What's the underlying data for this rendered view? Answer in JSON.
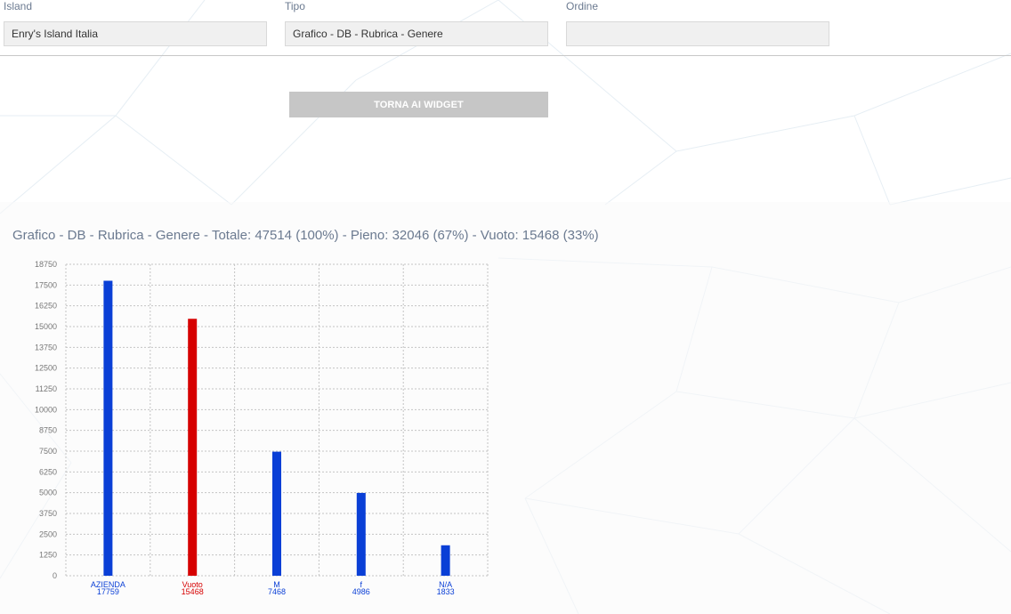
{
  "form": {
    "island": {
      "label": "Island",
      "value": "Enry's Island Italia"
    },
    "tipo": {
      "label": "Tipo",
      "value": "Grafico - DB - Rubrica - Genere"
    },
    "ordine": {
      "label": "Ordine",
      "value": ""
    }
  },
  "back_button_label": "TORNA AI WIDGET",
  "chart_data": {
    "type": "bar",
    "title": "Grafico - DB - Rubrica - Genere - Totale: 47514 (100%) - Pieno: 32046 (67%) - Vuoto: 15468 (33%)",
    "categories": [
      "AZIENDA",
      "Vuoto",
      "M",
      "f",
      "N/A"
    ],
    "values": [
      17759,
      15468,
      7468,
      4986,
      1833
    ],
    "bar_colors": [
      "#0a3fd6",
      "#d60000",
      "#0a3fd6",
      "#0a3fd6",
      "#0a3fd6"
    ],
    "ylim": [
      0,
      18750
    ],
    "yticks": [
      0,
      1250,
      2500,
      3750,
      5000,
      6250,
      7500,
      8750,
      10000,
      11250,
      12500,
      13750,
      15000,
      16250,
      17500,
      18750
    ],
    "grid": true,
    "xlabel": "",
    "ylabel": ""
  }
}
